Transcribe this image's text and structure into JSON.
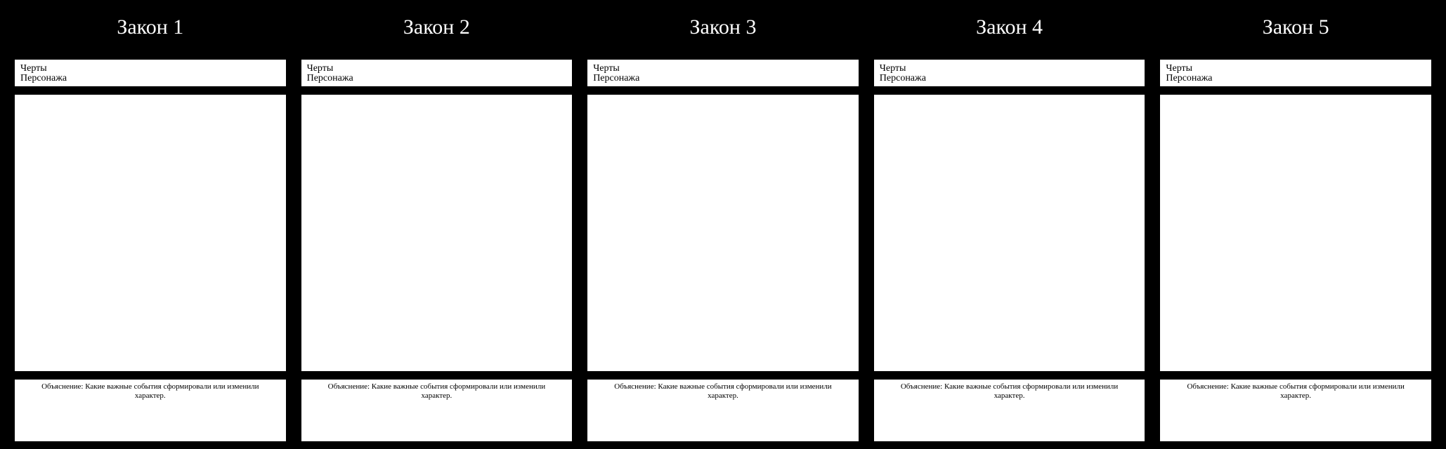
{
  "columns": [
    {
      "title": "Закон 1",
      "traits_line1": "Черты",
      "traits_line2": "Персонажа",
      "explanation": "Объяснение: Какие важные события сформировали или изменили характер."
    },
    {
      "title": "Закон 2",
      "traits_line1": "Черты",
      "traits_line2": "Персонажа",
      "explanation": "Объяснение: Какие важные события сформировали или изменили характер."
    },
    {
      "title": "Закон 3",
      "traits_line1": "Черты",
      "traits_line2": "Персонажа",
      "explanation": "Объяснение: Какие важные события сформировали или изменили характер."
    },
    {
      "title": "Закон 4",
      "traits_line1": "Черты",
      "traits_line2": "Персонажа",
      "explanation": "Объяснение: Какие важные события сформировали или изменили характер."
    },
    {
      "title": "Закон 5",
      "traits_line1": "Черты",
      "traits_line2": "Персонажа",
      "explanation": "Объяснение: Какие важные события сформировали или изменили характер."
    }
  ]
}
